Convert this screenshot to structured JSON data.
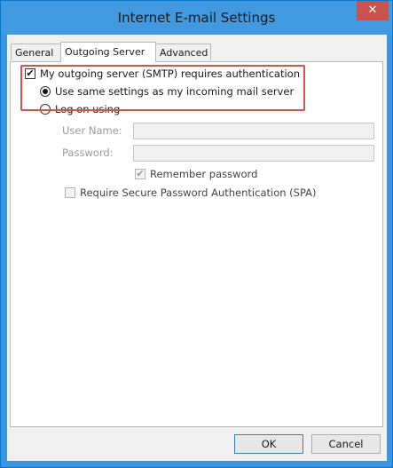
{
  "window": {
    "title": "Internet E-mail Settings",
    "close_glyph": "✕"
  },
  "tabs": [
    {
      "label": "General",
      "active": false
    },
    {
      "label": "Outgoing Server",
      "active": true
    },
    {
      "label": "Advanced",
      "active": false
    }
  ],
  "outgoing": {
    "requires_auth_label": "My outgoing server (SMTP) requires authentication",
    "requires_auth_checked": true,
    "use_same_label": "Use same settings as my incoming mail server",
    "use_same_selected": true,
    "log_on_label": "Log on using",
    "log_on_selected": false,
    "user_name_label": "User Name:",
    "user_name_value": "",
    "password_label": "Password:",
    "password_value": "",
    "remember_label": "Remember password",
    "remember_checked": true,
    "spa_label": "Require Secure Password Authentication (SPA)",
    "spa_checked": false
  },
  "buttons": {
    "ok": "OK",
    "cancel": "Cancel"
  },
  "check_glyph": "✔",
  "colors": {
    "titlebar": "#4199e0",
    "close": "#c9524e",
    "highlight": "#d4544e"
  }
}
